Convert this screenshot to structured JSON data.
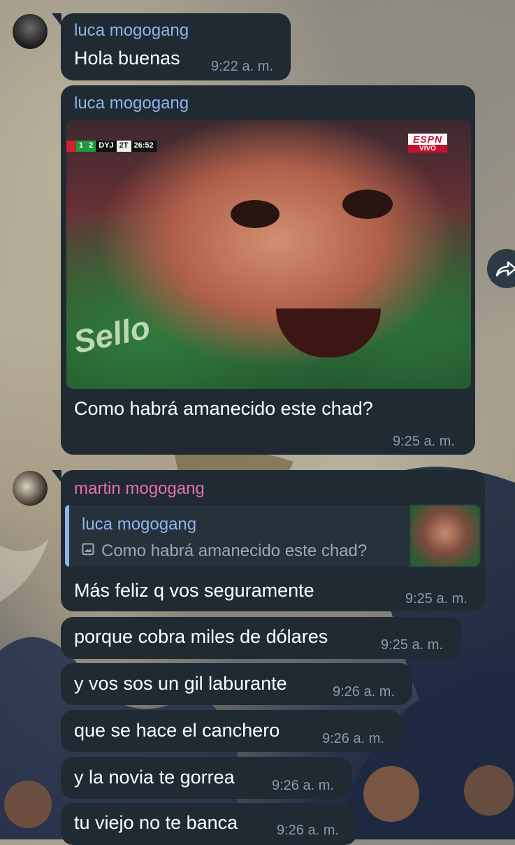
{
  "messages": [
    {
      "sender": "luca mogogang",
      "text": "Hola buenas",
      "time": "9:22 a. m."
    },
    {
      "sender": "luca mogogang",
      "caption": "Como habrá amanecido este chad?",
      "time": "9:25 a. m.",
      "media": {
        "scorebug": {
          "score_a": "1",
          "score_b": "2",
          "team": "DYJ",
          "half": "2T",
          "clock": "26:52"
        },
        "channel_logo": "ESPN",
        "live_label": "VIVO",
        "jersey_text": "Sello"
      }
    },
    {
      "sender": "martin mogogang",
      "reply": {
        "sender": "luca mogogang",
        "text": "Como habrá amanecido este chad?",
        "icon": "photo-icon"
      },
      "text": "Más feliz q vos seguramente",
      "time": "9:25 a. m."
    },
    {
      "text": "porque cobra miles de dólares",
      "time": "9:25 a. m."
    },
    {
      "text": "y vos sos un gil laburante",
      "time": "9:26 a. m."
    },
    {
      "text": "que se hace el canchero",
      "time": "9:26 a. m."
    },
    {
      "text": "y la novia te gorrea",
      "time": "9:26 a. m."
    },
    {
      "text": "tu viejo no te banca",
      "time": "9:26 a. m."
    }
  ],
  "share_button": {
    "icon": "share-forward-icon"
  },
  "colors": {
    "bubble": "#1f2a33",
    "sender_luca": "#8fb4e8",
    "sender_martin": "#e46fa9",
    "time": "#8a9aa6"
  }
}
